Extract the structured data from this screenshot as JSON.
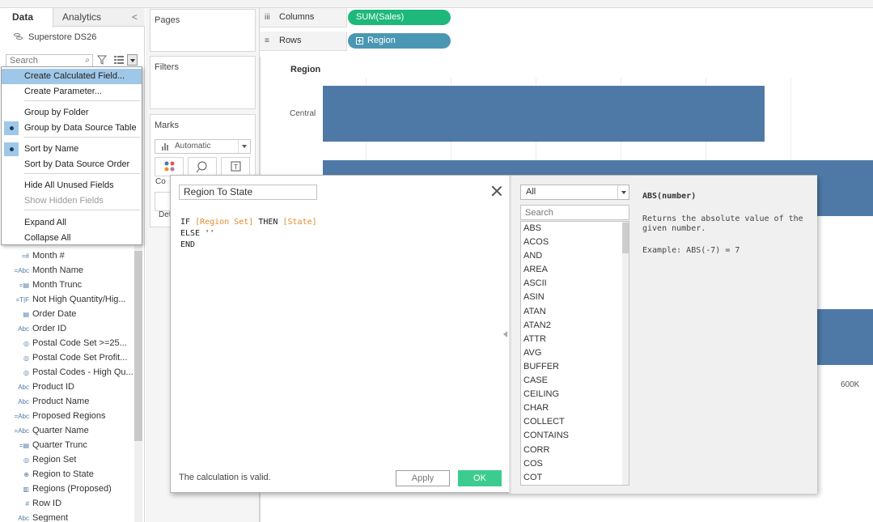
{
  "data_pane": {
    "tab_data": "Data",
    "tab_analytics": "Analytics",
    "collapse_glyph": "<",
    "datasource": "Superstore DS26",
    "search_placeholder": "Search"
  },
  "context_menu": {
    "items": [
      {
        "label": "Create Calculated Field...",
        "highlighted": true
      },
      {
        "label": "Create Parameter..."
      },
      {
        "label": "Group by Folder"
      },
      {
        "label": "Group by Data Source Table",
        "checked": true
      },
      {
        "label": "Sort by Name",
        "checked": true
      },
      {
        "label": "Sort by Data Source Order"
      },
      {
        "label": "Hide All Unused Fields"
      },
      {
        "label": "Show Hidden Fields",
        "disabled": true
      },
      {
        "label": "Expand All"
      },
      {
        "label": "Collapse All"
      }
    ]
  },
  "fields": [
    {
      "icon": "=#",
      "label": "Month #"
    },
    {
      "icon": "=Abc",
      "label": "Month Name"
    },
    {
      "icon": "=date",
      "label": "Month Trunc"
    },
    {
      "icon": "=T|F",
      "label": "Not High Quantity/Hig..."
    },
    {
      "icon": "date",
      "label": "Order Date"
    },
    {
      "icon": "Abc",
      "label": "Order ID"
    },
    {
      "icon": "set",
      "label": "Postal Code Set >=25..."
    },
    {
      "icon": "set",
      "label": "Postal Code Set Profit..."
    },
    {
      "icon": "set",
      "label": "Postal Codes - High Qu..."
    },
    {
      "icon": "Abc",
      "label": "Product ID"
    },
    {
      "icon": "Abc",
      "label": "Product Name"
    },
    {
      "icon": "=Abc",
      "label": "Proposed Regions"
    },
    {
      "icon": "=Abc",
      "label": "Quarter Name"
    },
    {
      "icon": "=date",
      "label": "Quarter Trunc"
    },
    {
      "icon": "set",
      "label": "Region Set"
    },
    {
      "icon": "globe",
      "label": "Region to State"
    },
    {
      "icon": "group",
      "label": "Regions (Proposed)"
    },
    {
      "icon": "#",
      "label": "Row ID"
    },
    {
      "icon": "Abc",
      "label": "Segment"
    }
  ],
  "cards": {
    "pages": "Pages",
    "filters": "Filters",
    "marks": "Marks",
    "marks_type": "Automatic",
    "color_btn_label": "Co",
    "detail_btn_label": "Det"
  },
  "shelves": {
    "columns_label": "Columns",
    "columns_pill": "SUM(Sales)",
    "rows_label": "Rows",
    "rows_pill": "Region"
  },
  "view": {
    "header": "Region",
    "row_label": "Central",
    "axis_tick": "600K",
    "bar_color": "#4e79a7"
  },
  "chart_data": {
    "type": "bar",
    "categories": [
      "Central"
    ],
    "values": [
      501240
    ],
    "xlabel": "",
    "ylabel": "Region",
    "note_visible_tick": "600K"
  },
  "dialog": {
    "calc_name": "Region To State",
    "code_line1_kw1": "IF",
    "code_line1_field1": "[Region Set]",
    "code_line1_kw2": "THEN",
    "code_line1_field2": "[State]",
    "code_line2": "ELSE ''",
    "code_line3": "END",
    "status": "The calculation is valid.",
    "apply_label": "Apply",
    "ok_label": "OK",
    "ok_color": "#3dcc8f",
    "field_color": "#e6882f"
  },
  "functions": {
    "category": "All",
    "search_placeholder": "Search",
    "list": [
      "ABS",
      "ACOS",
      "AND",
      "AREA",
      "ASCII",
      "ASIN",
      "ATAN",
      "ATAN2",
      "ATTR",
      "AVG",
      "BUFFER",
      "CASE",
      "CEILING",
      "CHAR",
      "COLLECT",
      "CONTAINS",
      "CORR",
      "COS",
      "COT"
    ],
    "selected_signature": "ABS(number)",
    "selected_description": "Returns the absolute value of the given number.",
    "selected_example": "Example: ABS(-7) = 7"
  }
}
